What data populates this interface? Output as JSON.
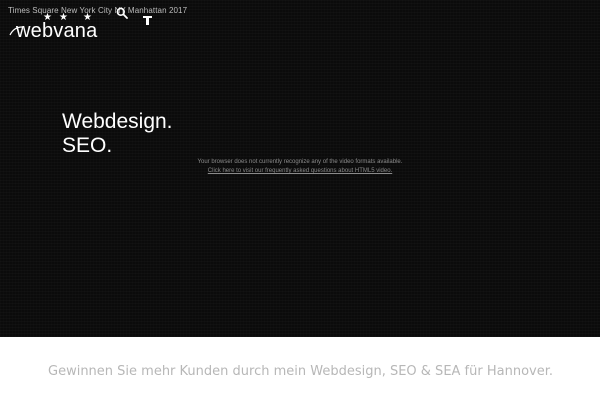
{
  "hero": {
    "caption": "Times Square New York City NY Manhattan 2017",
    "logo_text": "webvana",
    "headline_line1": "Webdesign.",
    "headline_line2": "SEO.",
    "video_message": "Your browser does not currently recognize any of the video formats available.",
    "video_link": "Click here to visit our frequently asked questions about HTML5 video."
  },
  "content": {
    "tagline": "Gewinnen Sie mehr Kunden durch mein Webdesign, SEO & SEA für Hannover."
  },
  "colors": {
    "hero_background": "#0b0b0b",
    "text_light": "#ffffff",
    "caption": "#bdbdbd",
    "tagline": "#b7b7b7"
  },
  "icons": [
    "search-icon",
    "cursor-icon",
    "star-icon"
  ]
}
